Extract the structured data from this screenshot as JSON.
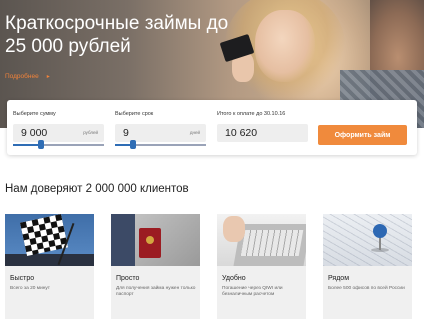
{
  "hero": {
    "title": "Краткосрочные займы до 25 000 рублей",
    "more_link": "Подробнее",
    "more_arrow": "▸"
  },
  "calculator": {
    "amount": {
      "label": "Выберите сумму",
      "value": "9 000",
      "unit": "рублей",
      "slider_fraction": 0.31
    },
    "term": {
      "label": "Выберите срок",
      "value": "9",
      "unit": "дней",
      "slider_fraction": 0.2
    },
    "total": {
      "label": "Итого к оплате до 30.10.16",
      "value": "10 620"
    },
    "submit_label": "Оформить займ"
  },
  "trust_heading": "Нам доверяют 2 000 000 клиентов",
  "features": [
    {
      "title": "Быстро",
      "desc": "Всего за 20 минут",
      "icon": "checkered-flag-icon"
    },
    {
      "title": "Просто",
      "desc": "Для получения займа нужен только паспорт",
      "icon": "passport-icon"
    },
    {
      "title": "Удобно",
      "desc": "Погашение через QIWI или безналичным расчетом",
      "icon": "laptop-icon"
    },
    {
      "title": "Рядом",
      "desc": "Более 500 офисов по всей России",
      "icon": "map-pin-icon"
    }
  ],
  "colors": {
    "accent": "#f08a3c",
    "slider": "#2f6db5",
    "field_bg": "#eeeeee",
    "tile_bg": "#f0f0f0"
  }
}
